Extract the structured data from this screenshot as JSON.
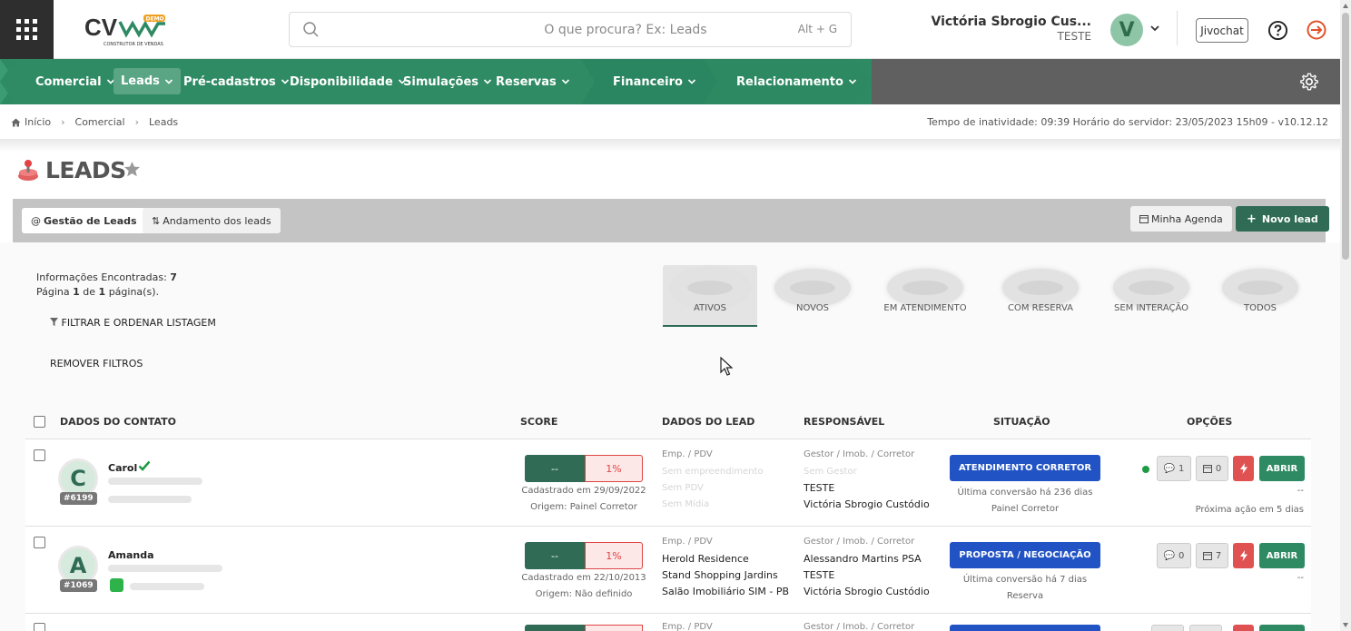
{
  "header": {
    "search_placeholder": "O que procura? Ex: Leads",
    "search_shortcut": "Alt + G",
    "user_name": "Victória Sbrogio Cus...",
    "user_role": "TESTE",
    "avatar_initial": "V",
    "jivochat": "Jivochat",
    "logo_text": "CV",
    "logo_badge": "DEMO",
    "logo_sub": "CONSTRUTOR DE VENDAS"
  },
  "nav": {
    "items": [
      {
        "label": "Comercial"
      },
      {
        "label": "Leads"
      },
      {
        "label": "Pré-cadastros"
      },
      {
        "label": "Disponibilidade"
      },
      {
        "label": "Simulações"
      },
      {
        "label": "Reservas"
      },
      {
        "label": "Financeiro"
      },
      {
        "label": "Relacionamento"
      }
    ],
    "active": "Leads"
  },
  "breadcrumb": {
    "home": "Início",
    "level1": "Comercial",
    "level2": "Leads"
  },
  "server_info": "Tempo de inatividade: 09:39  Horário do servidor: 23/05/2023 15h09 - v10.12.12",
  "page": {
    "title": "LEADS"
  },
  "toolbar": {
    "tab_gestao": "Gestão de Leads",
    "tab_andamento": "Andamento dos leads",
    "minha_agenda": "Minha Agenda",
    "novo_lead": "Novo lead"
  },
  "info": {
    "found_label": "Informações Encontradas:",
    "found_count": "7",
    "page_word": "Página",
    "page_num": "1",
    "of_word": "de",
    "page_total": "1",
    "pages_word": "página(s)."
  },
  "filters": {
    "filter_label": "FILTRAR E ORDENAR LISTAGEM",
    "remove_label": "REMOVER FILTROS"
  },
  "segments": [
    {
      "label": "ATIVOS"
    },
    {
      "label": "NOVOS"
    },
    {
      "label": "EM ATENDIMENTO"
    },
    {
      "label": "COM RESERVA"
    },
    {
      "label": "SEM INTERAÇÃO"
    },
    {
      "label": "TODOS"
    }
  ],
  "table": {
    "headers": {
      "contato": "DADOS DO CONTATO",
      "score": "SCORE",
      "lead": "DADOS DO LEAD",
      "responsavel": "RESPONSÁVEL",
      "situacao": "SITUAÇÃO",
      "opcoes": "OPÇÕES"
    },
    "rows": [
      {
        "initial": "C",
        "name": "Carol",
        "id": "#6199",
        "score_left": "--",
        "score_right": "1%",
        "cadastrado": "Cadastrado em 29/09/2022",
        "origem": "Origem: Painel Corretor",
        "lead_header": "Emp. / PDV",
        "lead_l1": "Sem empreendimento",
        "lead_l2": "Sem PDV",
        "lead_l3": "Sem Mídia",
        "resp_header": "Gestor / Imob. / Corretor",
        "resp_l1": "Sem Gestor",
        "resp_l2": "TESTE",
        "resp_l3": "Victória Sbrogio Custódio",
        "status": "ATENDIMENTO CORRETOR",
        "status_meta1": "Última conversão há 236 dias",
        "status_meta2": "Painel Corretor",
        "msgs": "1",
        "agenda": "0",
        "open": "ABRIR",
        "opt_meta1": "--",
        "opt_meta2": "Próxima ação em 5 dias"
      },
      {
        "initial": "A",
        "name": "Amanda",
        "id": "#1069",
        "score_left": "--",
        "score_right": "1%",
        "cadastrado": "Cadastrado em 22/10/2013",
        "origem": "Origem: Não definido",
        "lead_header": "Emp. / PDV",
        "lead_l1": "Herold Residence",
        "lead_l2": "Stand Shopping Jardins",
        "lead_l3": "Salão Imobiliário SIM - PB",
        "resp_header": "Gestor / Imob. / Corretor",
        "resp_l1": "Alessandro Martins PSA",
        "resp_l2": "TESTE",
        "resp_l3": "Victória Sbrogio Custódio",
        "status": "PROPOSTA / NEGOCIAÇÃO",
        "status_meta1": "Última conversão há 7 dias",
        "status_meta2": "Reserva",
        "msgs": "0",
        "agenda": "7",
        "open": "ABRIR",
        "opt_meta1": "--",
        "opt_meta2": ""
      },
      {
        "lead_header": "Emp. / PDV",
        "resp_header": "Gestor / Imob. / Corretor"
      }
    ]
  },
  "colors": {
    "brand_green": "#2e8a63",
    "dark_green": "#2f6b55",
    "status_blue": "#2153c4",
    "alert_red": "#e05252"
  }
}
